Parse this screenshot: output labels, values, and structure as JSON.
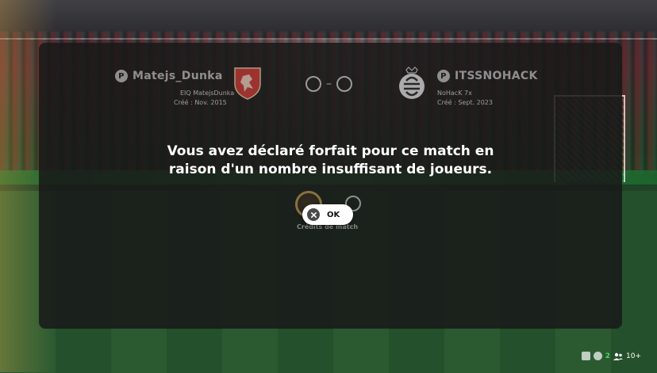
{
  "home": {
    "name": "Matejs_Dunka",
    "club": "EIQ MatejsDunka",
    "created": "Créé : Nov. 2015"
  },
  "away": {
    "name": "ITSSNOHACK",
    "club": "NoHacK 7x",
    "created": "Créé : Sept. 2023"
  },
  "score": {
    "separator": "–"
  },
  "message": {
    "line1": "Vous avez déclaré forfait pour ce match en",
    "line2": "raison d'un nombre insuffisant de joueurs."
  },
  "rewards": {
    "label": "Crédits de match"
  },
  "ok_button": {
    "label": "OK"
  },
  "status_bar": {
    "friends_online": "2",
    "party": "10+"
  },
  "colors": {
    "accent_green": "#4dd36a",
    "crest_red": "#c63a34"
  }
}
